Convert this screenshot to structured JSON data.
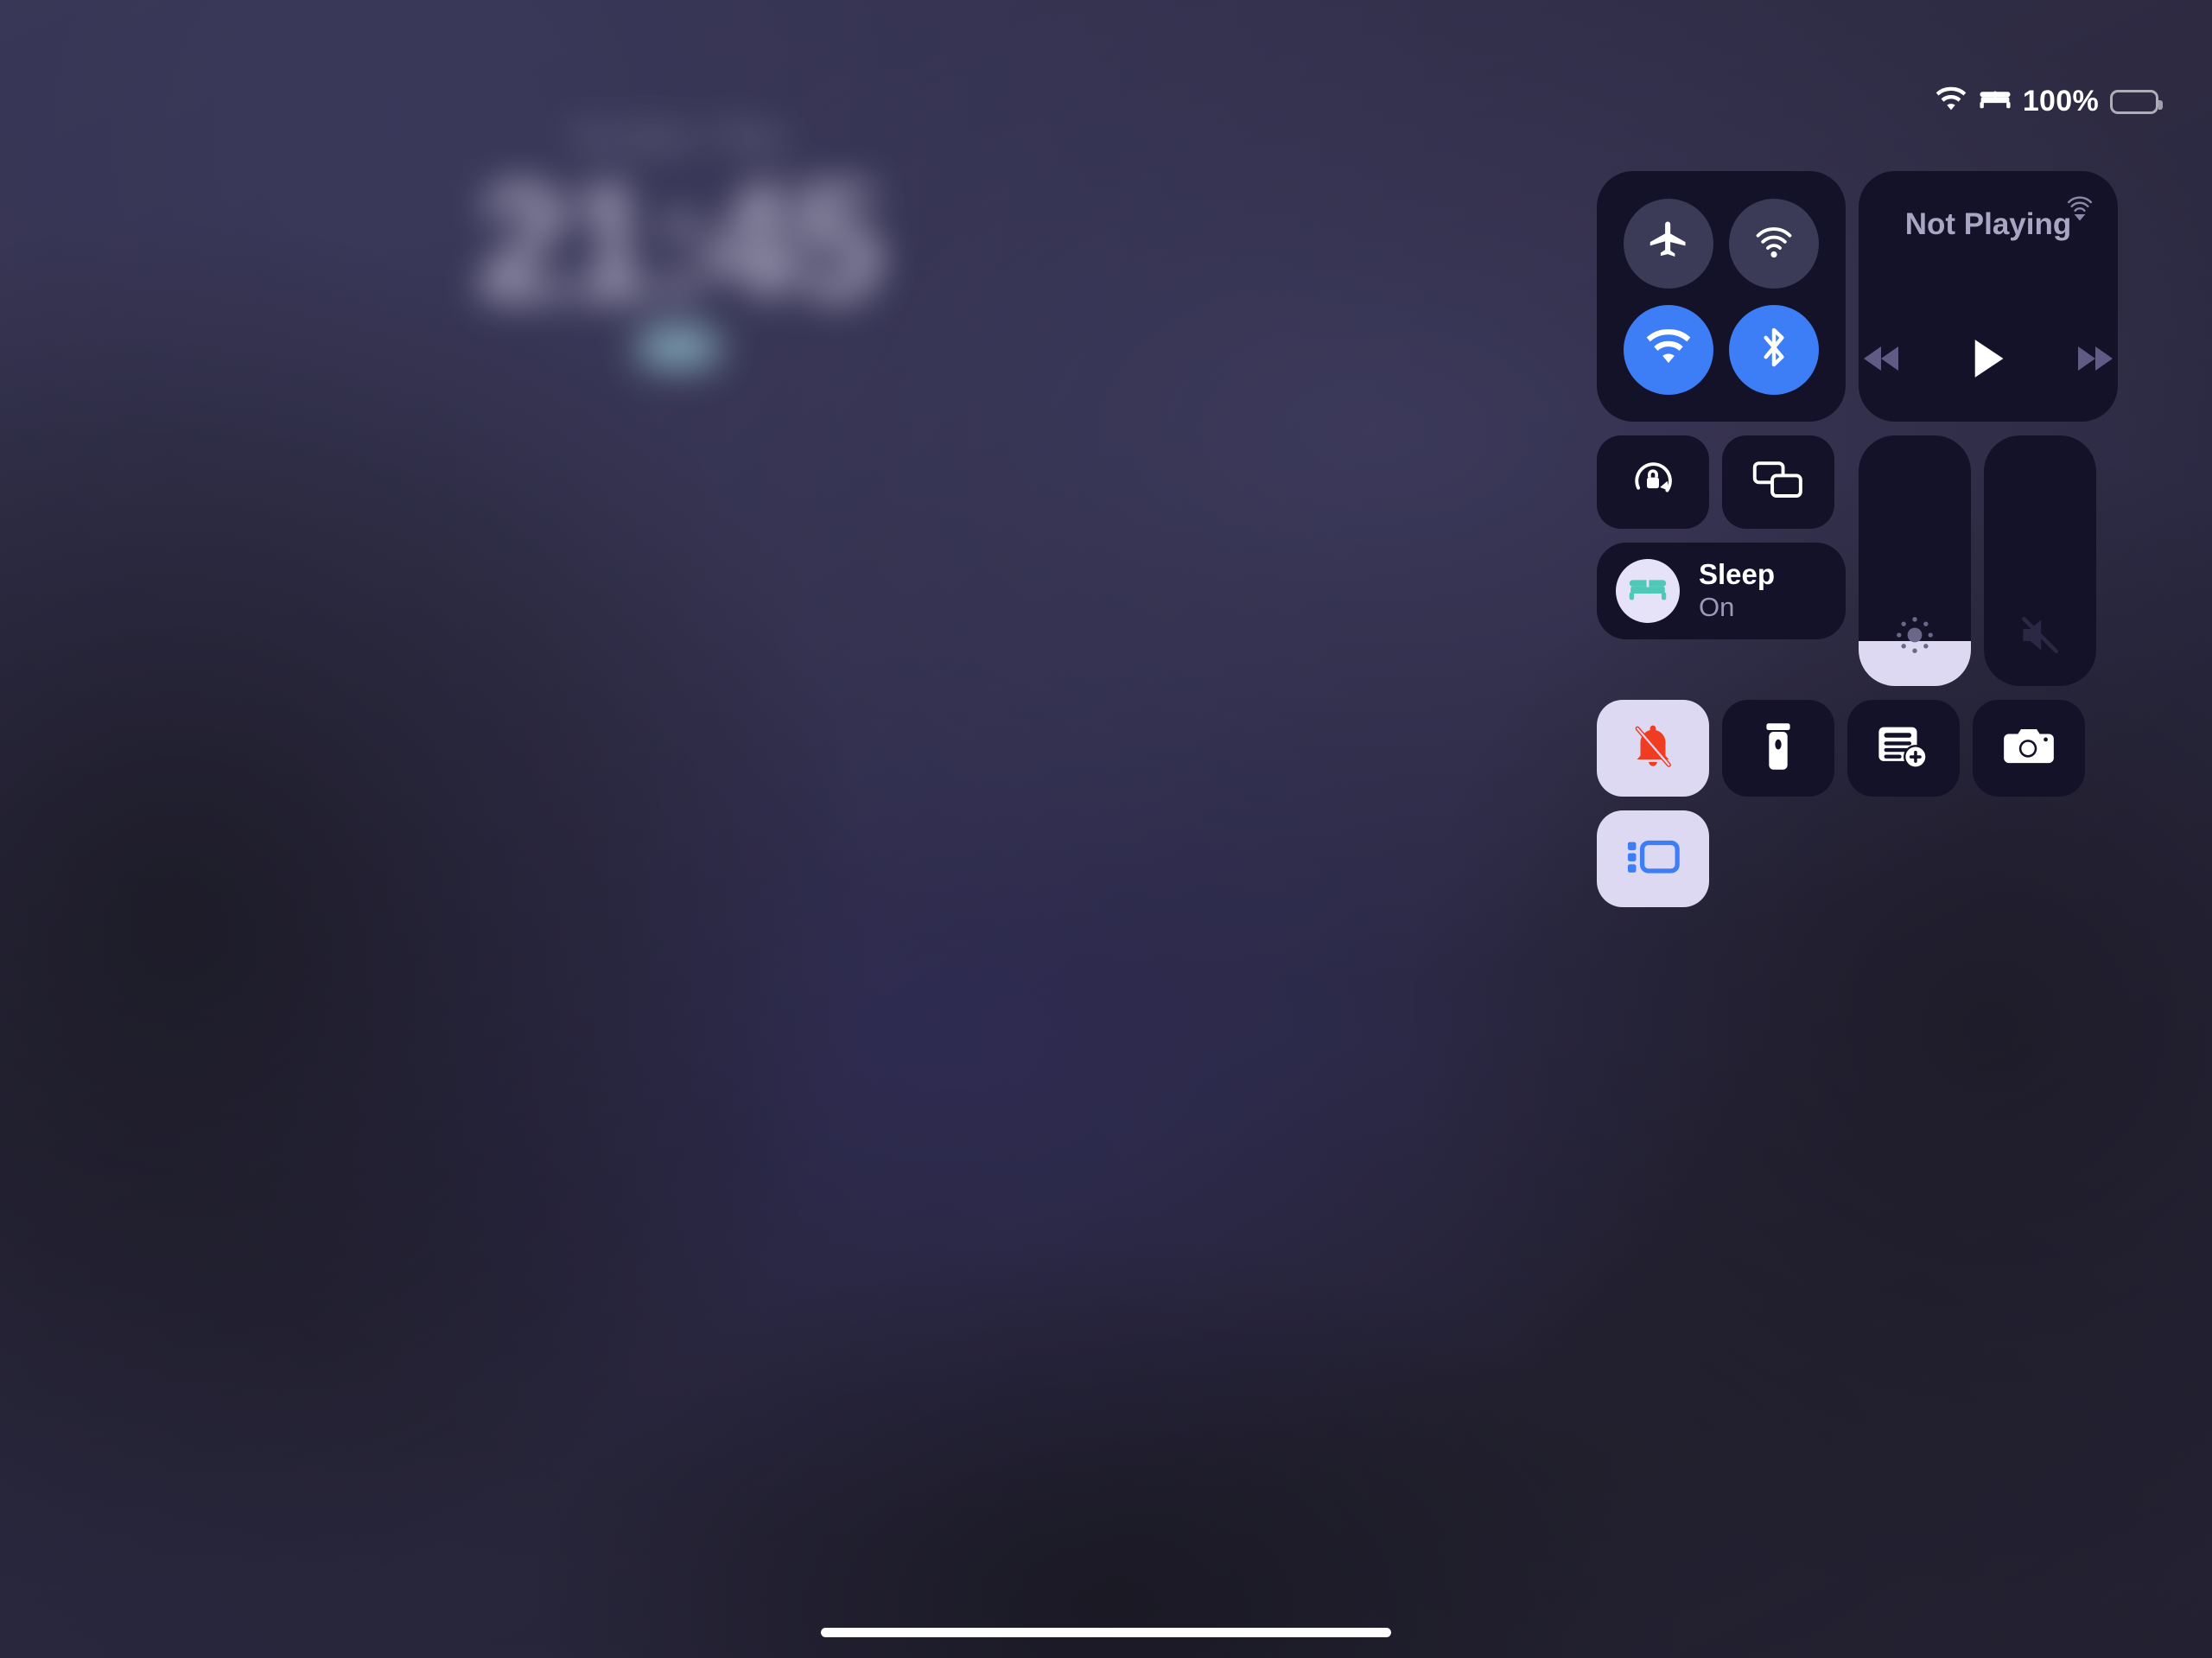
{
  "wallpaper": {
    "accent": "#2d2a42",
    "dark": "#232131"
  },
  "lock_screen": {
    "date": "Tuesday 7 May",
    "time": "21:45",
    "widget_color": "#9fd2dd"
  },
  "status_bar": {
    "wifi_icon": "wifi-icon",
    "focus_icon": "bed-icon",
    "battery_percent": "100%",
    "battery_icon": "battery-full-icon"
  },
  "control_center": {
    "connectivity": {
      "toggles": [
        {
          "name": "airplane-mode",
          "icon": "airplane-icon",
          "state": "off"
        },
        {
          "name": "airdrop",
          "icon": "airdrop-icon",
          "state": "off"
        },
        {
          "name": "wifi",
          "icon": "wifi-icon",
          "state": "on"
        },
        {
          "name": "bluetooth",
          "icon": "bluetooth-icon",
          "state": "on"
        }
      ],
      "on_color": "#3d7df6",
      "off_color": "#3b3a57"
    },
    "media": {
      "title": "Not Playing",
      "airplay_icon": "airplay-audio-icon",
      "controls": [
        {
          "name": "rewind",
          "icon": "rewind-icon"
        },
        {
          "name": "play",
          "icon": "play-icon"
        },
        {
          "name": "fast-forward",
          "icon": "fast-forward-icon"
        }
      ]
    },
    "mini_buttons": [
      {
        "name": "rotation-lock",
        "icon": "rotation-lock-icon",
        "state": "off"
      },
      {
        "name": "screen-mirroring",
        "icon": "screen-mirroring-icon",
        "state": "off"
      }
    ],
    "focus": {
      "name": "Sleep",
      "state": "On",
      "icon": "bed-icon",
      "icon_color": "#4ec9b8",
      "circle_color": "#e6e2f7"
    },
    "brightness": {
      "label": "brightness-slider",
      "icon": "brightness-icon",
      "value_percent": 18,
      "fill_color": "#ddd9f2"
    },
    "volume": {
      "label": "volume-slider",
      "icon": "speaker-muted-icon",
      "value_percent": 0,
      "fill_color": "#ddd9f2"
    },
    "buttons": [
      {
        "name": "silent-mode",
        "icon": "bell-slash-icon",
        "state": "on",
        "icon_color": "#f03c21"
      },
      {
        "name": "flashlight",
        "icon": "flashlight-icon",
        "state": "off",
        "icon_color": "#ffffff"
      },
      {
        "name": "new-note",
        "icon": "note-add-icon",
        "state": "off",
        "icon_color": "#ffffff"
      },
      {
        "name": "camera",
        "icon": "camera-icon",
        "state": "off",
        "icon_color": "#ffffff"
      },
      {
        "name": "stage-manager",
        "icon": "stage-manager-icon",
        "state": "on",
        "icon_color": "#3d7df6"
      }
    ]
  },
  "home_indicator": {
    "name": "home-indicator"
  }
}
